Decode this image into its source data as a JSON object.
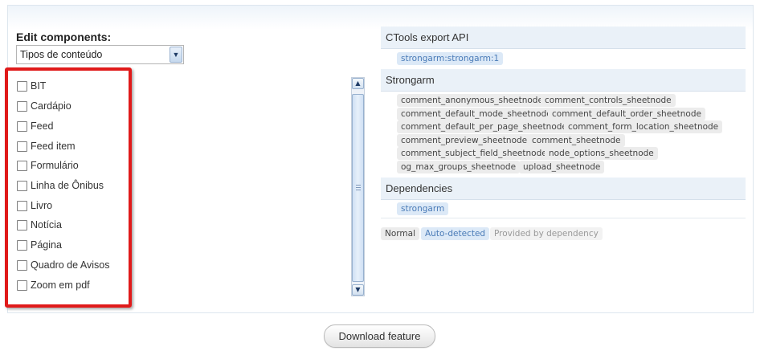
{
  "left": {
    "edit_label": "Edit components:",
    "select_value": "Tipos de conteúdo",
    "items": [
      "BIT",
      "Cardápio",
      "Feed",
      "Feed item",
      "Formulário",
      "Linha de Ônibus",
      "Livro",
      "Notícia",
      "Página",
      "Quadro de Avisos",
      "Zoom em pdf"
    ]
  },
  "right": {
    "sections": [
      {
        "title": "CTools export API",
        "tags": [
          "strongarm:strongarm:1"
        ],
        "tag_style": "auto"
      },
      {
        "title": "Strongarm",
        "tags": [
          "comment_anonymous_sheetnode",
          "comment_controls_sheetnode",
          "comment_default_mode_sheetnode",
          "comment_default_order_sheetnode",
          "comment_default_per_page_sheetnode",
          "comment_form_location_sheetnode",
          "comment_preview_sheetnode",
          "comment_sheetnode",
          "comment_subject_field_sheetnode",
          "node_options_sheetnode",
          "og_max_groups_sheetnode",
          "upload_sheetnode"
        ],
        "tag_style": "normal"
      },
      {
        "title": "Dependencies",
        "tags": [
          "strongarm"
        ],
        "tag_style": "auto"
      }
    ],
    "legend": {
      "normal": "Normal",
      "auto": "Auto-detected",
      "dependency": "Provided by dependency"
    }
  },
  "actions": {
    "download_label": "Download feature"
  },
  "colors": {
    "highlight": "#e01a1a",
    "auto_tag_bg": "#dce9f7",
    "auto_tag_text": "#4a7bb7",
    "header_bg": "#eaf1f8"
  },
  "icons": {
    "select_arrow": "chevron-down-icon",
    "scroll_up": "arrow-up-icon",
    "scroll_down": "arrow-down-icon"
  }
}
